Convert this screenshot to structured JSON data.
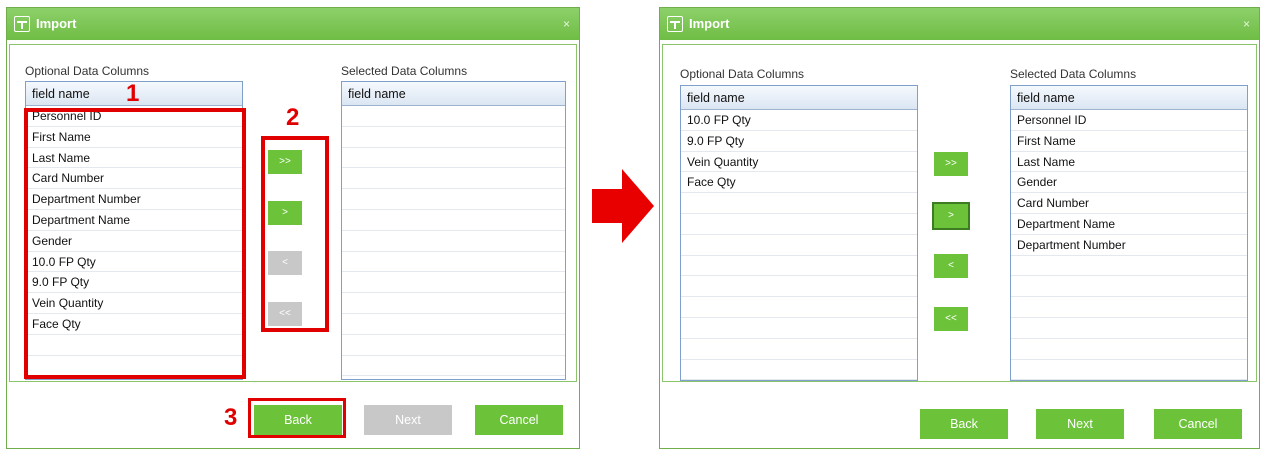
{
  "colors": {
    "accent": "#6cc33a",
    "disabled": "#c8c8c8",
    "annotation": "#e00000"
  },
  "dialog_before": {
    "title": "Import",
    "close_icon": "×",
    "optional_label": "Optional Data Columns",
    "selected_label": "Selected Data Columns",
    "optional_header": "field name",
    "selected_header": "field name",
    "optional_items": [
      "Personnel ID",
      "First Name",
      "Last Name",
      "Card Number",
      "Department Number",
      "Department Name",
      "Gender",
      "10.0 FP Qty",
      "9.0 FP Qty",
      "Vein Quantity",
      "Face Qty",
      "",
      ""
    ],
    "selected_items": [
      "",
      "",
      "",
      "",
      "",
      "",
      "",
      "",
      "",
      "",
      "",
      "",
      ""
    ],
    "buttons": {
      "add_all": ">>",
      "add": ">",
      "remove": "<",
      "remove_all": "<<"
    },
    "footer": {
      "back": "Back",
      "next": "Next",
      "cancel": "Cancel"
    }
  },
  "annotations": {
    "step1": "1",
    "step2": "2",
    "step3": "3"
  },
  "dialog_after": {
    "title": "Import",
    "close_icon": "×",
    "optional_label": "Optional Data Columns",
    "selected_label": "Selected Data Columns",
    "optional_header": "field name",
    "selected_header": "field name",
    "optional_items": [
      "10.0 FP Qty",
      "9.0 FP Qty",
      "Vein Quantity",
      "Face Qty",
      "",
      "",
      "",
      "",
      "",
      "",
      "",
      "",
      ""
    ],
    "selected_items": [
      "Personnel ID",
      "First Name",
      "Last Name",
      "Gender",
      "Card Number",
      "Department Name",
      "Department Number",
      "",
      "",
      "",
      "",
      "",
      ""
    ],
    "buttons": {
      "add_all": ">>",
      "add": ">",
      "remove": "<",
      "remove_all": "<<"
    },
    "footer": {
      "back": "Back",
      "next": "Next",
      "cancel": "Cancel"
    }
  },
  "arrow_icon": "right-arrow-icon"
}
